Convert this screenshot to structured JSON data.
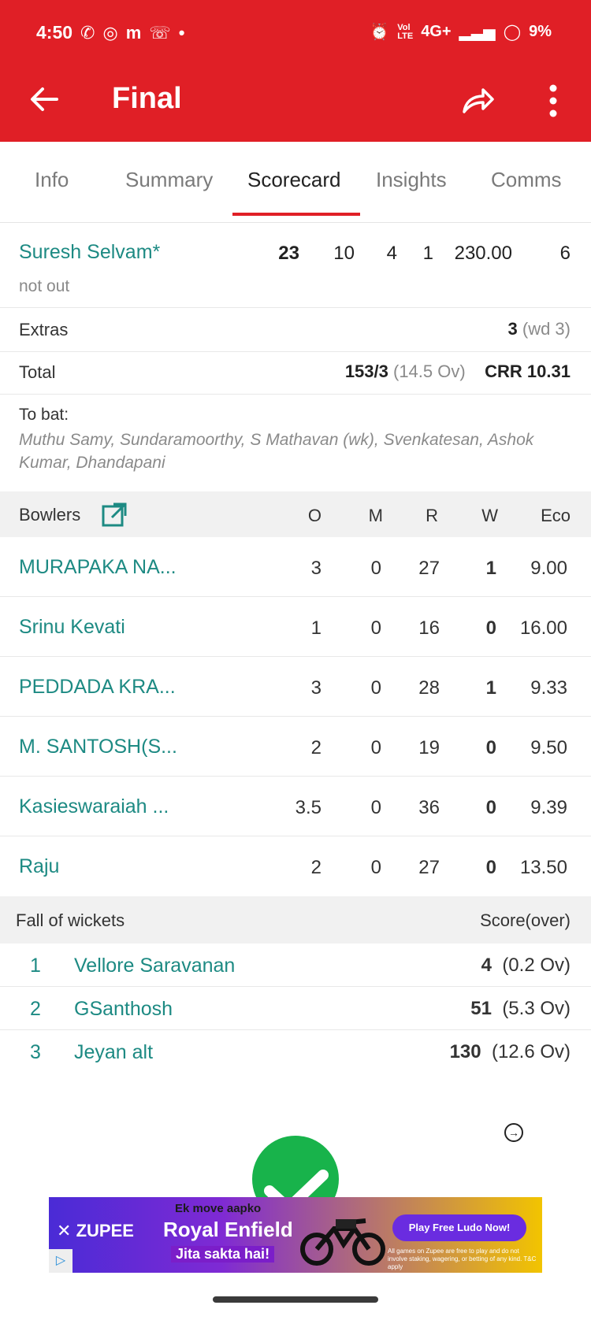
{
  "status_bar": {
    "time": "4:50",
    "notif_icons": [
      "whatsapp-icon",
      "instagram-icon",
      "m-app-icon",
      "missed-call-icon",
      "dot-icon"
    ],
    "network": "4G+",
    "battery": "9%"
  },
  "app_bar": {
    "title": "Final"
  },
  "tabs": [
    {
      "label": "Info"
    },
    {
      "label": "Summary"
    },
    {
      "label": "Scorecard"
    },
    {
      "label": "Insights"
    },
    {
      "label": "Comms"
    }
  ],
  "batter": {
    "name": "Suresh Selvam*",
    "dismissal": "not out",
    "runs": "23",
    "balls": "10",
    "fours": "4",
    "sixes": "1",
    "sr": "230.00",
    "extra_col": "6"
  },
  "extras": {
    "label": "Extras",
    "value": "3",
    "detail": "(wd 3)"
  },
  "total": {
    "label": "Total",
    "score": "153/3",
    "overs": "(14.5 Ov)",
    "crr": "CRR 10.31"
  },
  "to_bat": {
    "label": "To bat:",
    "names": "Muthu Samy, Sundaramoorthy, S Mathavan (wk), Svenkatesan, Ashok Kumar, Dhandapani"
  },
  "bowlers_header": {
    "label": "Bowlers",
    "cols": [
      "O",
      "M",
      "R",
      "W",
      "Eco"
    ]
  },
  "bowlers": [
    {
      "name": "MURAPAKA NA...",
      "o": "3",
      "m": "0",
      "r": "27",
      "w": "1",
      "eco": "9.00"
    },
    {
      "name": "Srinu Kevati",
      "o": "1",
      "m": "0",
      "r": "16",
      "w": "0",
      "eco": "16.00"
    },
    {
      "name": "PEDDADA KRA...",
      "o": "3",
      "m": "0",
      "r": "28",
      "w": "1",
      "eco": "9.33"
    },
    {
      "name": "M. SANTOSH(S...",
      "o": "2",
      "m": "0",
      "r": "19",
      "w": "0",
      "eco": "9.50"
    },
    {
      "name": "Kasieswaraiah ...",
      "o": "3.5",
      "m": "0",
      "r": "36",
      "w": "0",
      "eco": "9.39"
    },
    {
      "name": "Raju",
      "o": "2",
      "m": "0",
      "r": "27",
      "w": "0",
      "eco": "13.50"
    }
  ],
  "fow_header": {
    "label": "Fall of wickets",
    "right": "Score(over)"
  },
  "fall_of_wickets": [
    {
      "num": "1",
      "name": "Vellore Saravanan",
      "score": "4",
      "over": "(0.2 Ov)"
    },
    {
      "num": "2",
      "name": "GSanthosh",
      "score": "51",
      "over": "(5.3 Ov)"
    },
    {
      "num": "3",
      "name": "Jeyan alt",
      "score": "130",
      "over": "(12.6 Ov)"
    }
  ],
  "ad": {
    "brand": "ZUPEE",
    "line1": "Ek move aapko",
    "line2": "Royal Enfield",
    "line3": "Jita sakta hai!",
    "cta": "Play Free Ludo Now!",
    "fine": "All games on Zupee are free to play and do not involve staking, wagering, or betting of any kind. T&C apply"
  },
  "colors": {
    "accent": "#e01f26",
    "link": "#1d8a83",
    "check": "#18b34b"
  }
}
